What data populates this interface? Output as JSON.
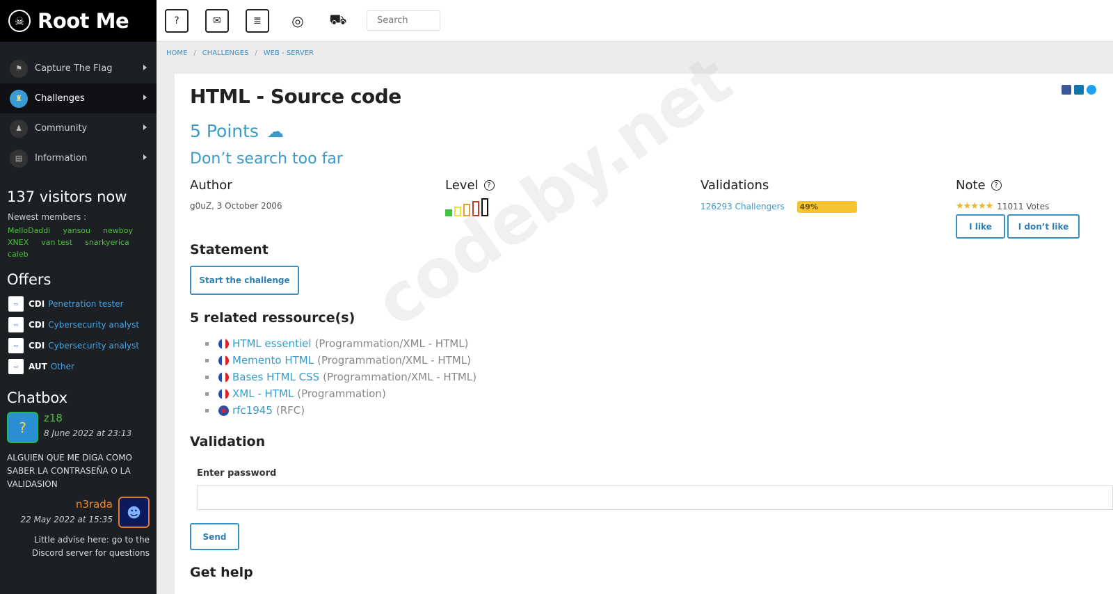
{
  "sidebar": {
    "logo_text": "Root Me",
    "nav": [
      {
        "label": "Capture The Flag",
        "icon": "flag-icon"
      },
      {
        "label": "Challenges",
        "icon": "trophy-icon"
      },
      {
        "label": "Community",
        "icon": "person-icon"
      },
      {
        "label": "Information",
        "icon": "info-icon"
      }
    ],
    "visitors": "137 visitors now",
    "newest_label": "Newest members :",
    "members": [
      "MelloDaddi",
      "yansou",
      "newboy",
      "XNEX",
      "van test",
      "snarkyerica",
      "caleb"
    ],
    "offers_title": "Offers",
    "offers": [
      {
        "type": "CDI",
        "role": "Penetration tester"
      },
      {
        "type": "CDI",
        "role": "Cybersecurity analyst"
      },
      {
        "type": "CDI",
        "role": "Cybersecurity analyst"
      },
      {
        "type": "AUT",
        "role": "Other"
      }
    ],
    "chat_title": "Chatbox",
    "chat": [
      {
        "user": "z18",
        "date": "8 June 2022 at 23:13",
        "text": "ALGUIEN QUE ME DIGA COMO SABER LA CONTRASEÑA O LA VALIDASION"
      },
      {
        "user": "n3rada",
        "date": "22 May 2022 at 15:35",
        "text": "Little advise here: go to the Discord server for questions"
      }
    ]
  },
  "topbar": {
    "icons": [
      "faq-icon",
      "chat-icon",
      "docs-icon",
      "scores-icon",
      "cart-icon"
    ],
    "search_placeholder": "Search"
  },
  "breadcrumb": [
    "HOME",
    "CHALLENGES",
    "WEB - SERVER"
  ],
  "challenge": {
    "title": "HTML - Source code",
    "points": "5 Points",
    "subtitle": "Don’t search too far",
    "author_label": "Author",
    "author_value": "g0uZ,  3 October 2006",
    "level_label": "Level",
    "level": 1,
    "level_max": 5,
    "validations_label": "Validations",
    "validations_value": "126293 Challengers",
    "validations_percent": "49%",
    "note_label": "Note",
    "rating_stars": 5,
    "votes": "11011 Votes",
    "like_label": "I like",
    "dislike_label": "I don’t like",
    "statement_label": "Statement",
    "start_label": "Start the challenge",
    "resources_title": "5 related ressource(s)",
    "resources": [
      {
        "lang": "fr",
        "title": "HTML essentiel",
        "category": "(Programmation/XML - HTML)"
      },
      {
        "lang": "fr",
        "title": "Memento HTML",
        "category": "(Programmation/XML - HTML)"
      },
      {
        "lang": "fr",
        "title": "Bases HTML CSS",
        "category": "(Programmation/XML - HTML)"
      },
      {
        "lang": "fr",
        "title": "XML - HTML",
        "category": "(Programmation)"
      },
      {
        "lang": "en",
        "title": "rfc1945",
        "category": "(RFC)"
      }
    ],
    "validation_title": "Validation",
    "password_label": "Enter password",
    "send_label": "Send",
    "help_title": "Get help"
  },
  "watermark": "codeby.net",
  "colors": {
    "accent": "#3a9bc9",
    "sidebar_bg": "#1c1f24",
    "member_green": "#4ec33a",
    "progress": "#f4c431"
  }
}
